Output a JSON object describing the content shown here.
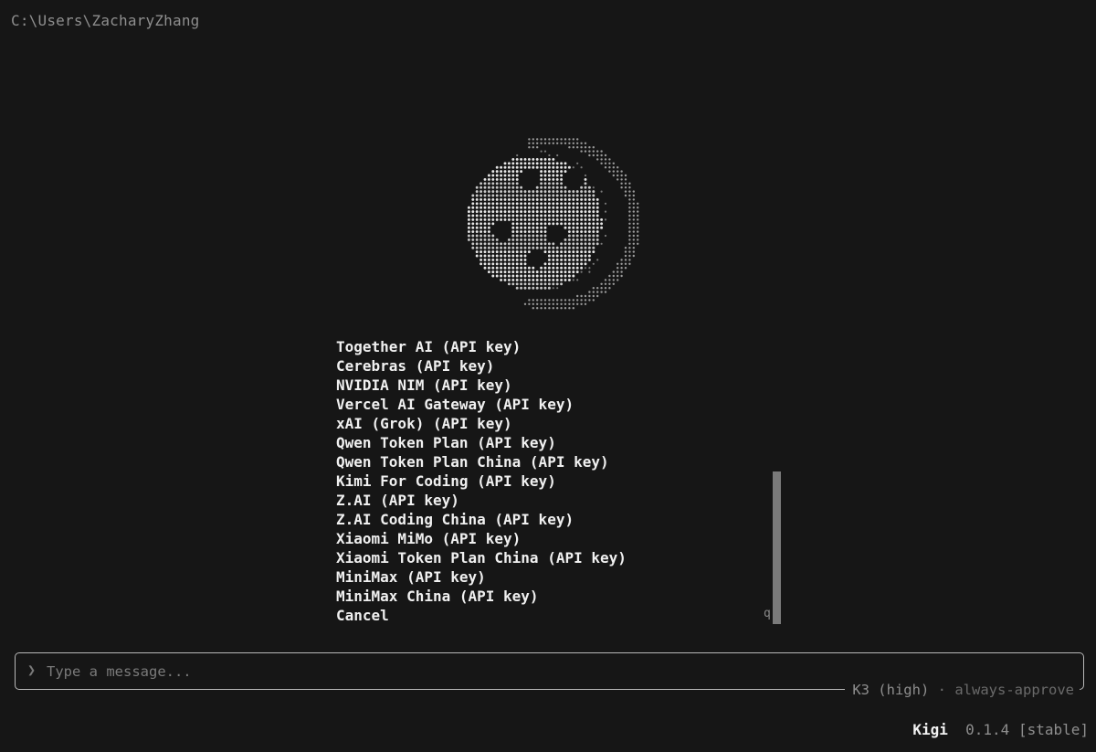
{
  "cwd": "C:\\Users\\ZacharyZhang",
  "logo": {
    "icon": "dotted-moon-face-icon"
  },
  "menu": {
    "items": [
      "Together AI (API key)",
      "Cerebras (API key)",
      "NVIDIA NIM (API key)",
      "Vercel AI Gateway (API key)",
      "xAI (Grok) (API key)",
      "Qwen Token Plan (API key)",
      "Qwen Token Plan China (API key)",
      "Kimi For Coding (API key)",
      "Z.AI (API key)",
      "Z.AI Coding China (API key)",
      "Xiaomi MiMo (API key)",
      "Xiaomi Token Plan China (API key)",
      "MiniMax (API key)",
      "MiniMax China (API key)",
      "Cancel"
    ],
    "scroll_hint": "q"
  },
  "input": {
    "chevron": "❯",
    "placeholder": "Type a message..."
  },
  "status": {
    "model": "K3 (high)",
    "separator": "·",
    "mode": "always-approve"
  },
  "footer": {
    "app_name": "Kigi",
    "version": "0.1.4 [stable]"
  },
  "colors": {
    "background": "#161616",
    "text": "#f0f0f0",
    "muted": "#8e8e8e",
    "border": "#b8b8b8"
  }
}
